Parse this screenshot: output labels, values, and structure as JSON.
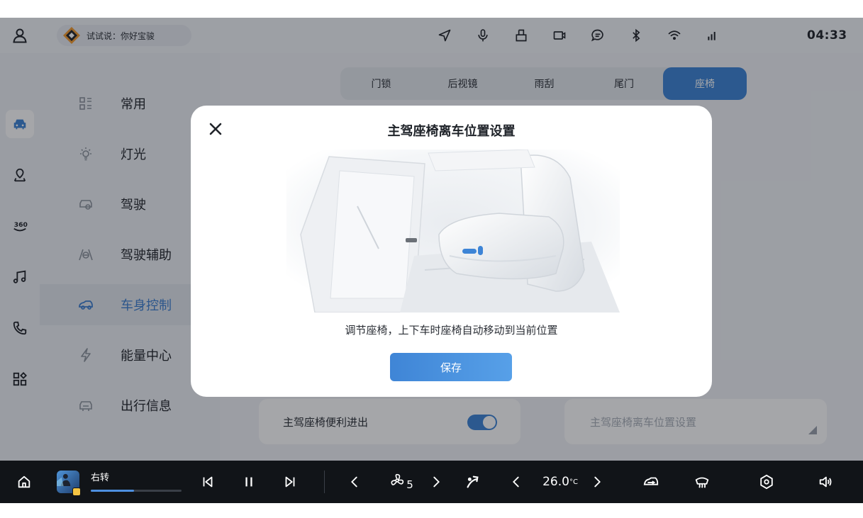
{
  "voice": {
    "prompt": "试试说：你好宝骏"
  },
  "status": {
    "time": "04:33"
  },
  "menu": {
    "items": [
      {
        "label": "常用",
        "icon": "grid-icon",
        "active": false
      },
      {
        "label": "灯光",
        "icon": "bulb-icon",
        "active": false
      },
      {
        "label": "驾驶",
        "icon": "car-icon",
        "active": false
      },
      {
        "label": "驾驶辅助",
        "icon": "assist-icon",
        "active": false
      },
      {
        "label": "车身控制",
        "icon": "car-body-icon",
        "active": true
      },
      {
        "label": "能量中心",
        "icon": "lightning-icon",
        "active": false
      },
      {
        "label": "出行信息",
        "icon": "trip-icon",
        "active": false
      }
    ]
  },
  "tabs": [
    {
      "label": "门锁",
      "active": false
    },
    {
      "label": "后视镜",
      "active": false
    },
    {
      "label": "雨刮",
      "active": false
    },
    {
      "label": "尾门",
      "active": false
    },
    {
      "label": "座椅",
      "active": true
    }
  ],
  "cards": {
    "easy_entry": {
      "label": "主驾座椅便利进出",
      "toggle_on": true
    },
    "exit_position": {
      "label": "主驾座椅离车位置设置"
    }
  },
  "modal": {
    "title": "主驾座椅离车位置设置",
    "description": "调节座椅，上下车时座椅自动移动到当前位置",
    "save_label": "保存"
  },
  "media": {
    "track": "右转",
    "progress": 0.48
  },
  "climate": {
    "fan_level": "5",
    "temperature": "26.0",
    "temperature_unit": "°C"
  },
  "colors": {
    "accent": "#3d84d6",
    "dock": "#111418"
  }
}
